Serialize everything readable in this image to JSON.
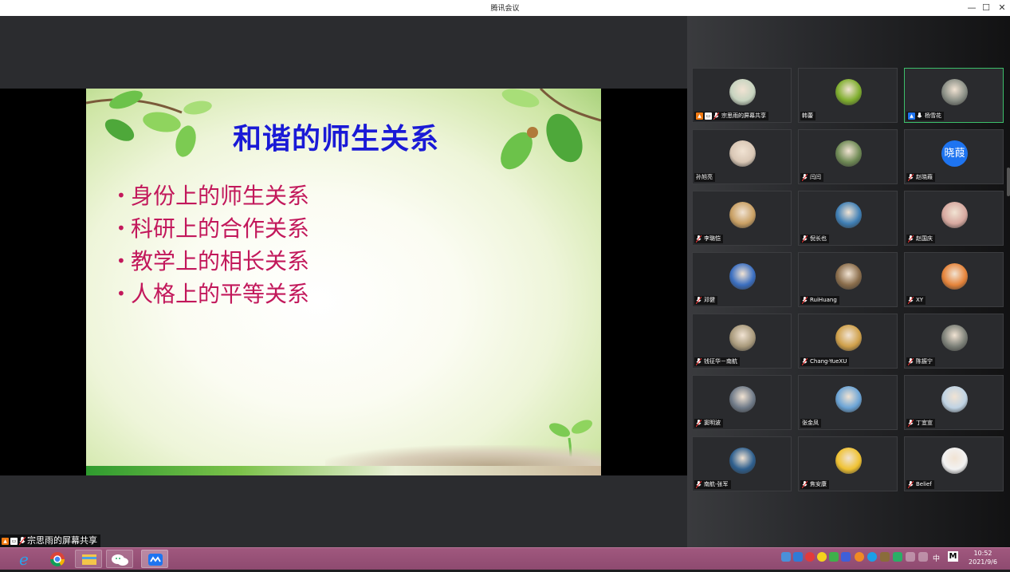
{
  "window": {
    "title": "腾讯会议",
    "minimize": "—",
    "maximize": "☐",
    "close": "✕"
  },
  "slide": {
    "title": "和谐的师生关系",
    "bullet_glyph": "•",
    "bullets": [
      "身份上的师生关系",
      "科研上的合作关系",
      "教学上的相长关系",
      "人格上的平等关系"
    ]
  },
  "participants": [
    {
      "name": "宗思雨的屏幕共享",
      "avatar": "person-photo",
      "color": "#c7d4c0"
    },
    {
      "name": "韩蕾",
      "avatar": "daisy-photo",
      "color": "#7fae2e"
    },
    {
      "name": "杨雪花",
      "avatar": "tree-photo",
      "color": "#8a8f86"
    },
    {
      "name": "孙旭亮",
      "avatar": "person-photo",
      "color": "#d9c7b5"
    },
    {
      "name": "闫闫",
      "avatar": "person-photo",
      "color": "#6f8a55"
    },
    {
      "name": "赵晓葭",
      "avatar_text": "晓葭",
      "color": "#1e74f0"
    },
    {
      "name": "李璐恺",
      "avatar": "sunset-photo",
      "color": "#c9a064"
    },
    {
      "name": "倪长也",
      "avatar": "lake-photo",
      "color": "#3f7fb5"
    },
    {
      "name": "赵国庆",
      "avatar": "child-photo",
      "color": "#d7a9a0"
    },
    {
      "name": "邓健",
      "avatar": "person-photo",
      "color": "#3b6fc1"
    },
    {
      "name": "RuiHuang",
      "avatar": "city-photo",
      "color": "#8a6d4b"
    },
    {
      "name": "XY",
      "avatar": "leaf-photo",
      "color": "#e6843a"
    },
    {
      "name": "钱征华－南航",
      "avatar": "photo",
      "color": "#a99a7c"
    },
    {
      "name": "Chang-YueXU",
      "avatar": "toy-photo",
      "color": "#cfa04a"
    },
    {
      "name": "陈振宁",
      "avatar": "photo",
      "color": "#7c8078"
    },
    {
      "name": "窦明波",
      "avatar": "person-photo",
      "color": "#6f7a88"
    },
    {
      "name": "张金凤",
      "avatar": "child-photo",
      "color": "#6ba4d6"
    },
    {
      "name": "丁宜宣",
      "avatar": "cartoon-photo",
      "color": "#bfd3e4"
    },
    {
      "name": "南航-张军",
      "avatar": "dolphin-photo",
      "color": "#2e5f8e"
    },
    {
      "name": "焦安康",
      "avatar": "badge-photo",
      "color": "#f0c232"
    },
    {
      "name": "Belief",
      "avatar": "cartoon-photo",
      "color": "#f2f2f2"
    }
  ],
  "share_bar": {
    "label": "宗思雨的屏幕共享"
  },
  "taskbar": {
    "clock_time": "10:52",
    "clock_date": "2021/9/6",
    "tray_ime": "中",
    "tray_m": "M"
  },
  "colors": {
    "accent_green": "#3cbf6a",
    "slide_title": "#1a1ad6",
    "slide_bullet": "#c2185b",
    "taskbar": "#8e4a70"
  }
}
